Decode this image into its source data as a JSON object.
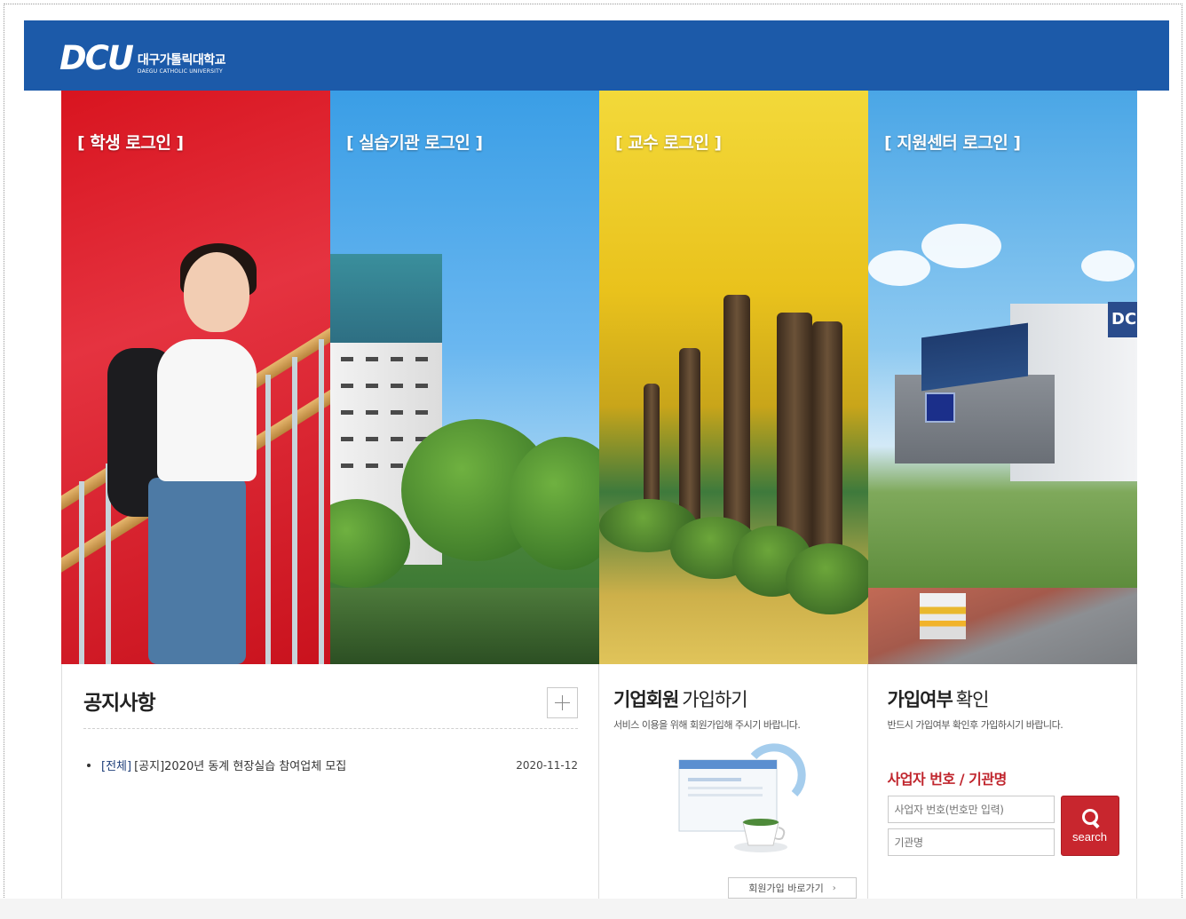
{
  "header": {
    "logo_mark": "DCU",
    "logo_ko": "대구가톨릭대학교",
    "logo_en": "DAEGU CATHOLIC UNIVERSITY"
  },
  "panels": [
    {
      "title": "[ 학생 로그인 ]"
    },
    {
      "title": "[ 실습기관 로그인 ]"
    },
    {
      "title": "[ 교수 로그인 ]"
    },
    {
      "title": "[ 지원센터 로그인 ]"
    }
  ],
  "notice": {
    "title": "공지사항",
    "items": [
      {
        "category": "[전체]",
        "subject": "[공지]2020년 동계 현장실습 참여업체 모집",
        "date": "2020-11-12"
      }
    ]
  },
  "join": {
    "title_bold": "기업회원",
    "title_light": "가입하기",
    "subtitle": "서비스 이용을 위해 회원가입해 주시기 바랍니다.",
    "link_label": "회원가입 바로가기",
    "link_arrow": "›"
  },
  "check": {
    "title_bold": "가입여부",
    "title_light": "확인",
    "subtitle": "반드시 가입여부 확인후 가입하시기 바랍니다.",
    "label": "사업자 번호 / 기관명",
    "input1_placeholder": "사업자 번호(번호만 입력)",
    "input2_placeholder": "기관명",
    "search_label": "search"
  },
  "colors": {
    "header_blue": "#1c5aa9",
    "accent_red": "#c8262e"
  }
}
